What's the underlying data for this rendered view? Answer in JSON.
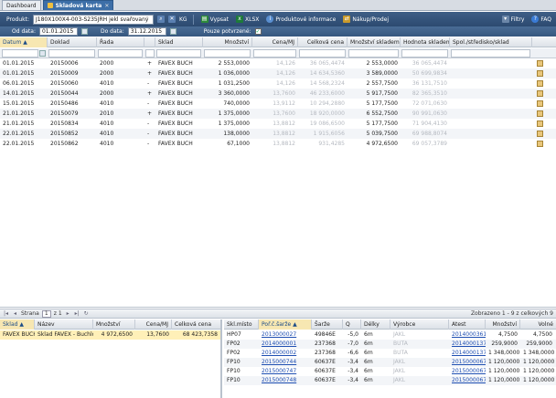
{
  "tabs": [
    {
      "label": "Dashboard",
      "active": false
    },
    {
      "label": "Skladová karta",
      "active": true
    }
  ],
  "toolbar": {
    "product_label": "Produkt:",
    "product_value": "J180X100X4-003-S235JRH jekl svařovaný",
    "unit": "KG",
    "vypsat": "Vypsat",
    "xlsx": "XLSX",
    "product_info": "Produktové informace",
    "purchase_sale": "Nákup/Prodej",
    "filter": "Filtry",
    "faq": "FAQ"
  },
  "filters": {
    "from_label": "Od data:",
    "from_value": "01.01.2015",
    "to_label": "Do data:",
    "to_value": "31.12.2015",
    "confirmed_label": "Pouze potvrzené:",
    "confirmed_checked": "✓"
  },
  "grid": {
    "columns": [
      "Datum",
      "Doklad",
      "Řada",
      "",
      "Sklad",
      "Množství",
      "Cena/MJ",
      "Celková cena",
      "Množství skladem",
      "Hodnota skladem",
      "Spol./středisko/sklad"
    ],
    "rows": [
      {
        "datum": "01.01.2015",
        "doklad": "20150006",
        "rada": "2000",
        "sign": "+",
        "sklad": "FAVEX BUCH",
        "mnozstvi": "2 553,0000",
        "cena": "14,126",
        "celkova": "36 065,4474",
        "skladem": "2 553,0000",
        "hodnota": "36 065,4474"
      },
      {
        "datum": "01.01.2015",
        "doklad": "20150009",
        "rada": "2000",
        "sign": "+",
        "sklad": "FAVEX BUCH",
        "mnozstvi": "1 036,0000",
        "cena": "14,126",
        "celkova": "14 634,5360",
        "skladem": "3 589,0000",
        "hodnota": "50 699,9834"
      },
      {
        "datum": "06.01.2015",
        "doklad": "20150060",
        "rada": "4010",
        "sign": "-",
        "sklad": "FAVEX BUCH",
        "mnozstvi": "1 031,2500",
        "cena": "14,126",
        "celkova": "14 568,2324",
        "skladem": "2 557,7500",
        "hodnota": "36 131,7510"
      },
      {
        "datum": "14.01.2015",
        "doklad": "20150044",
        "rada": "2000",
        "sign": "+",
        "sklad": "FAVEX BUCH",
        "mnozstvi": "3 360,0000",
        "cena": "13,7600",
        "celkova": "46 233,6000",
        "skladem": "5 917,7500",
        "hodnota": "82 365,3510"
      },
      {
        "datum": "15.01.2015",
        "doklad": "20150486",
        "rada": "4010",
        "sign": "-",
        "sklad": "FAVEX BUCH",
        "mnozstvi": "740,0000",
        "cena": "13,9112",
        "celkova": "10 294,2880",
        "skladem": "5 177,7500",
        "hodnota": "72 071,0630"
      },
      {
        "datum": "21.01.2015",
        "doklad": "20150079",
        "rada": "2010",
        "sign": "+",
        "sklad": "FAVEX BUCH",
        "mnozstvi": "1 375,0000",
        "cena": "13,7600",
        "celkova": "18 920,0000",
        "skladem": "6 552,7500",
        "hodnota": "90 991,0630"
      },
      {
        "datum": "21.01.2015",
        "doklad": "20150834",
        "rada": "4010",
        "sign": "-",
        "sklad": "FAVEX BUCH",
        "mnozstvi": "1 375,0000",
        "cena": "13,8812",
        "celkova": "19 086,6500",
        "skladem": "5 177,7500",
        "hodnota": "71 904,4130"
      },
      {
        "datum": "22.01.2015",
        "doklad": "20150852",
        "rada": "4010",
        "sign": "-",
        "sklad": "FAVEX BUCH",
        "mnozstvi": "138,0000",
        "cena": "13,8812",
        "celkova": "1 915,6056",
        "skladem": "5 039,7500",
        "hodnota": "69 988,8074"
      },
      {
        "datum": "22.01.2015",
        "doklad": "20150862",
        "rada": "4010",
        "sign": "-",
        "sklad": "FAVEX BUCH",
        "mnozstvi": "67,1000",
        "cena": "13,8812",
        "celkova": "931,4285",
        "skladem": "4 972,6500",
        "hodnota": "69 057,3789"
      }
    ]
  },
  "pager": {
    "page_label": "Strana",
    "page_value": "1",
    "of_label": "z 1",
    "summary": "Zobrazeno 1 - 9 z celkových 9"
  },
  "stock_summary": {
    "columns": [
      "Sklad",
      "Název",
      "Množství",
      "Cena/MJ",
      "Celková cena"
    ],
    "rows": [
      {
        "sklad": "FAVEX BUCH",
        "nazev": "Sklad FAVEX - Buchlovice",
        "mnozstvi": "4 972,6500",
        "cena": "13,7600",
        "celkova": "68 423,7358"
      }
    ]
  },
  "batches": {
    "columns": [
      "Skl.místo",
      "Poř.č.šarže",
      "Šarže",
      "Q",
      "Délky",
      "Výrobce",
      "Atest",
      "Množství",
      "Volné"
    ],
    "rows": [
      {
        "misto": "HP07",
        "por": "2013000027",
        "sarze": "49846E",
        "q": "-5,0",
        "delky": "6m",
        "vyrobce": "JAKL",
        "atest": "2014000361",
        "mnozstvi": "4,7500",
        "volne": "4,7500"
      },
      {
        "misto": "FP02",
        "por": "2014000001",
        "sarze": "237368",
        "q": "-7,0",
        "delky": "6m",
        "vyrobce": "BUTA",
        "atest": "2014000137",
        "mnozstvi": "259,9000",
        "volne": "259,9000"
      },
      {
        "misto": "FP02",
        "por": "2014000002",
        "sarze": "237368",
        "q": "-6,6",
        "delky": "6m",
        "vyrobce": "BUTA",
        "atest": "2014000137",
        "mnozstvi": "1 348,0000",
        "volne": "1 348,0000"
      },
      {
        "misto": "FP10",
        "por": "2015000744",
        "sarze": "60637E",
        "q": "-3,4",
        "delky": "6m",
        "vyrobce": "JAKL",
        "atest": "2015000067",
        "mnozstvi": "1 120,0000",
        "volne": "1 120,0000"
      },
      {
        "misto": "FP10",
        "por": "2015000747",
        "sarze": "60637E",
        "q": "-3,4",
        "delky": "6m",
        "vyrobce": "JAKL",
        "atest": "2015000067",
        "mnozstvi": "1 120,0000",
        "volne": "1 120,0000"
      },
      {
        "misto": "FP10",
        "por": "2015000748",
        "sarze": "60637E",
        "q": "-3,4",
        "delky": "6m",
        "vyrobce": "JAKL",
        "atest": "2015000067",
        "mnozstvi": "1 120,0000",
        "volne": "1 120,0000"
      }
    ]
  }
}
